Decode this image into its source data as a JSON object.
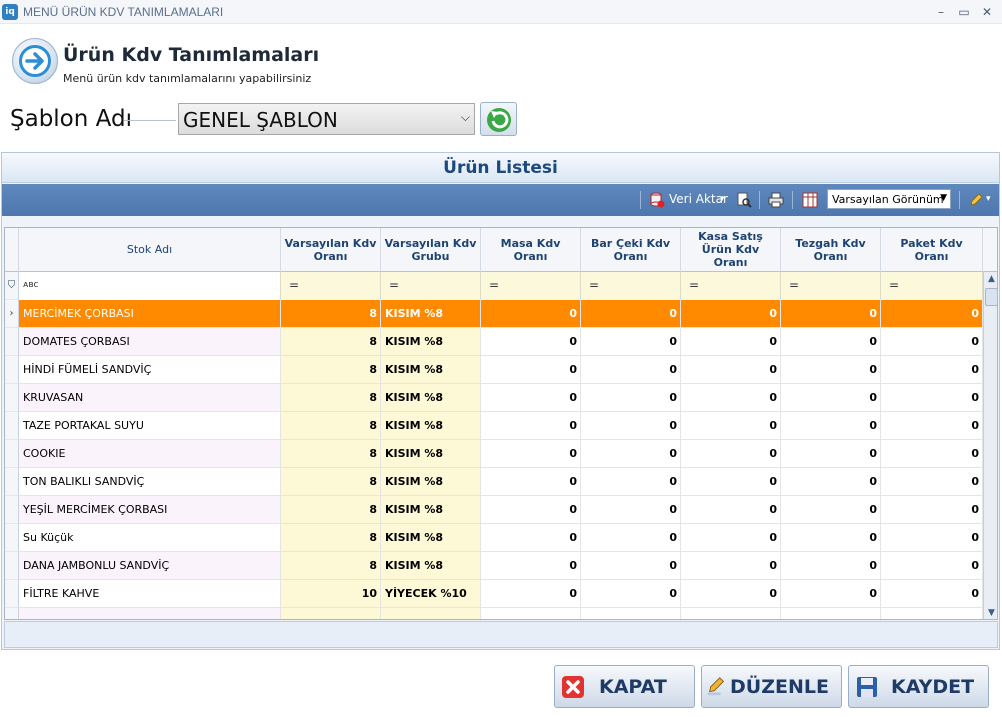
{
  "window": {
    "title": "MENÜ ÜRÜN KDV TANIMLAMALARI",
    "app_icon": "iq",
    "minimize": "–",
    "maximize": "▭",
    "close": "✕"
  },
  "header": {
    "title": "Ürün Kdv Tanımlamaları",
    "subtitle": "Menü ürün kdv tanımlamalarını yapabilirsiniz"
  },
  "template": {
    "label": "Şablon Adı",
    "selected": "GENEL ŞABLON"
  },
  "panel": {
    "title": "Ürün Listesi"
  },
  "toolbar": {
    "export_label": "Veri Aktar",
    "view_selected": "Varsayılan Görünüm"
  },
  "grid": {
    "columns": [
      "Stok Adı",
      "Varsayılan Kdv Oranı",
      "Varsayılan Kdv Grubu",
      "Masa Kdv Oranı",
      "Bar Çeki Kdv Oranı",
      "Kasa Satış Ürün Kdv Oranı",
      "Tezgah Kdv Oranı",
      "Paket Kdv Oranı"
    ],
    "filter_name": "ᴀʙc",
    "filter_eq": "=",
    "rows": [
      {
        "name": "MERCİMEK ÇORBASI",
        "kdv": "8",
        "group": "KISIM %8",
        "masa": "0",
        "bar": "0",
        "kasa": "0",
        "tezgah": "0",
        "paket": "0"
      },
      {
        "name": "DOMATES ÇORBASI",
        "kdv": "8",
        "group": "KISIM %8",
        "masa": "0",
        "bar": "0",
        "kasa": "0",
        "tezgah": "0",
        "paket": "0"
      },
      {
        "name": "HİNDİ FÜMELİ SANDVİÇ",
        "kdv": "8",
        "group": "KISIM %8",
        "masa": "0",
        "bar": "0",
        "kasa": "0",
        "tezgah": "0",
        "paket": "0"
      },
      {
        "name": "KRUVASAN",
        "kdv": "8",
        "group": "KISIM %8",
        "masa": "0",
        "bar": "0",
        "kasa": "0",
        "tezgah": "0",
        "paket": "0"
      },
      {
        "name": "TAZE PORTAKAL SUYU",
        "kdv": "8",
        "group": "KISIM %8",
        "masa": "0",
        "bar": "0",
        "kasa": "0",
        "tezgah": "0",
        "paket": "0"
      },
      {
        "name": "COOKIE",
        "kdv": "8",
        "group": "KISIM %8",
        "masa": "0",
        "bar": "0",
        "kasa": "0",
        "tezgah": "0",
        "paket": "0"
      },
      {
        "name": "TON BALIKLI SANDVİÇ",
        "kdv": "8",
        "group": "KISIM %8",
        "masa": "0",
        "bar": "0",
        "kasa": "0",
        "tezgah": "0",
        "paket": "0"
      },
      {
        "name": "YEŞİL MERCİMEK ÇORBASI",
        "kdv": "8",
        "group": "KISIM %8",
        "masa": "0",
        "bar": "0",
        "kasa": "0",
        "tezgah": "0",
        "paket": "0"
      },
      {
        "name": "Su Küçük",
        "kdv": "8",
        "group": "KISIM %8",
        "masa": "0",
        "bar": "0",
        "kasa": "0",
        "tezgah": "0",
        "paket": "0"
      },
      {
        "name": "DANA JAMBONLU SANDVİÇ",
        "kdv": "8",
        "group": "KISIM %8",
        "masa": "0",
        "bar": "0",
        "kasa": "0",
        "tezgah": "0",
        "paket": "0"
      },
      {
        "name": "FİLTRE KAHVE",
        "kdv": "10",
        "group": "YİYECEK %10",
        "masa": "0",
        "bar": "0",
        "kasa": "0",
        "tezgah": "0",
        "paket": "0"
      }
    ]
  },
  "buttons": {
    "close": "KAPAT",
    "edit": "DÜZENLE",
    "save": "KAYDET"
  },
  "colors": {
    "selected_row": "#ff8a00",
    "toolbar": "#5680b6",
    "filter_cell": "#fbf8dc"
  }
}
